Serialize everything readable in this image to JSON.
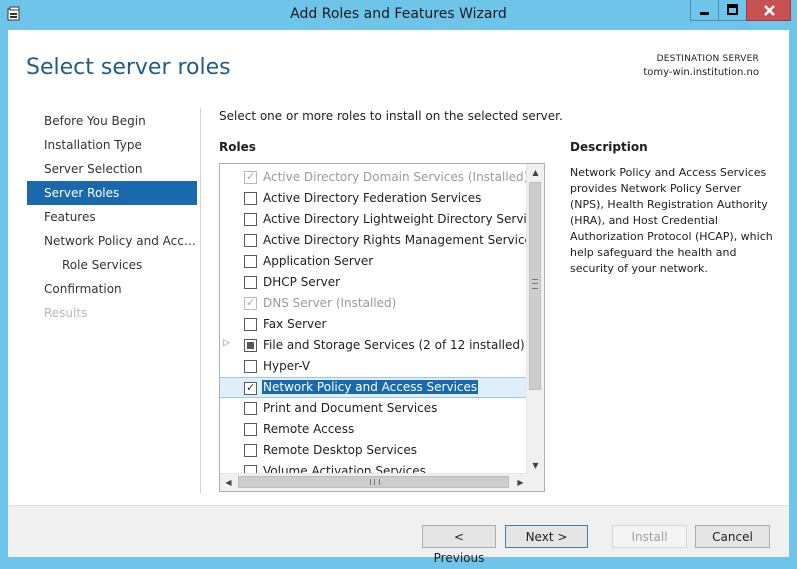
{
  "window": {
    "title": "Add Roles and Features Wizard",
    "controls": {
      "minimize": "minimize-icon",
      "maximize": "maximize-icon",
      "close": "close-icon"
    }
  },
  "header": {
    "page_title": "Select server roles",
    "destination_label": "DESTINATION SERVER",
    "destination_server": "tomy-win.institution.no"
  },
  "nav": {
    "items": [
      {
        "label": "Before You Begin",
        "state": "normal"
      },
      {
        "label": "Installation Type",
        "state": "normal"
      },
      {
        "label": "Server Selection",
        "state": "normal"
      },
      {
        "label": "Server Roles",
        "state": "active"
      },
      {
        "label": "Features",
        "state": "normal"
      },
      {
        "label": "Network Policy and Access Services",
        "state": "normal"
      },
      {
        "label": "Role Services",
        "state": "sub"
      },
      {
        "label": "Confirmation",
        "state": "normal"
      },
      {
        "label": "Results",
        "state": "disabled"
      }
    ]
  },
  "main": {
    "instruction": "Select one or more roles to install on the selected server.",
    "roles_label": "Roles",
    "roles": [
      {
        "label": "Active Directory Domain Services (Installed)",
        "checked": true,
        "disabled": true
      },
      {
        "label": "Active Directory Federation Services",
        "checked": false
      },
      {
        "label": "Active Directory Lightweight Directory Services",
        "checked": false
      },
      {
        "label": "Active Directory Rights Management Services",
        "checked": false
      },
      {
        "label": "Application Server",
        "checked": false
      },
      {
        "label": "DHCP Server",
        "checked": false
      },
      {
        "label": "DNS Server (Installed)",
        "checked": true,
        "disabled": true
      },
      {
        "label": "Fax Server",
        "checked": false
      },
      {
        "label": "File and Storage Services (2 of 12 installed)",
        "checked": "partial",
        "expandable": true
      },
      {
        "label": "Hyper-V",
        "checked": false
      },
      {
        "label": "Network Policy and Access Services",
        "checked": true,
        "selected": true
      },
      {
        "label": "Print and Document Services",
        "checked": false
      },
      {
        "label": "Remote Access",
        "checked": false
      },
      {
        "label": "Remote Desktop Services",
        "checked": false
      },
      {
        "label": "Volume Activation Services",
        "checked": false
      }
    ],
    "description_label": "Description",
    "description": "Network Policy and Access Services provides Network Policy Server (NPS), Health Registration Authority (HRA), and Host Credential Authorization Protocol (HCAP), which help safeguard the health and security of your network."
  },
  "footer": {
    "previous": "< Previous",
    "next": "Next >",
    "install": "Install",
    "cancel": "Cancel"
  }
}
